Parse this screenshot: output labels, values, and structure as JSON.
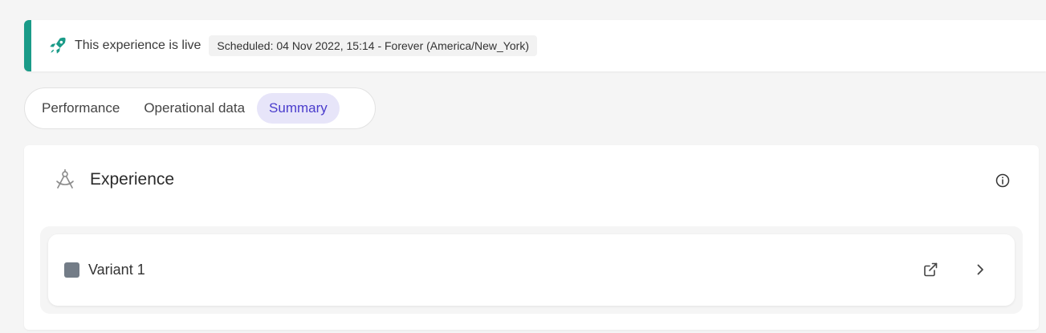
{
  "banner": {
    "icon": "rocket-icon",
    "status_text": "This experience is live",
    "schedule": "Scheduled: 04 Nov 2022, 15:14 - Forever (America/New_York)",
    "accent_color": "#1a9b88"
  },
  "tabs": [
    {
      "label": "Performance",
      "active": false
    },
    {
      "label": "Operational data",
      "active": false
    },
    {
      "label": "Summary",
      "active": true
    }
  ],
  "card": {
    "icon": "compass-drafting-icon",
    "title": "Experience",
    "info_icon": "info-icon",
    "variants": [
      {
        "label": "Variant 1",
        "color": "#737c87",
        "icons": [
          "external-link-icon",
          "chevron-right-icon"
        ]
      }
    ]
  },
  "colors": {
    "active_tab_bg": "#e7e5f9",
    "active_tab_text": "#4a3ccc"
  }
}
